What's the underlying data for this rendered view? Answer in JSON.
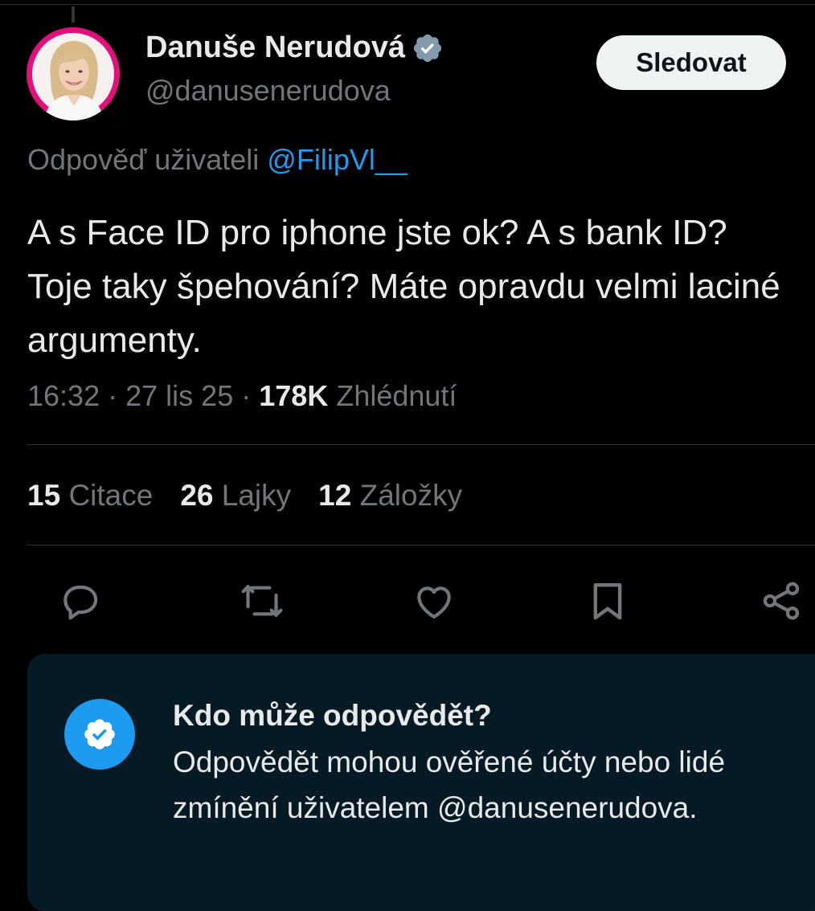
{
  "author": {
    "display_name": "Danuše Nerudová",
    "handle": "@danusenerudova",
    "verified": true
  },
  "follow_button": {
    "label": "Sledovat"
  },
  "reply_context": {
    "prefix": "Odpověď uživateli ",
    "mention": "@FilipVl__"
  },
  "tweet": {
    "text": "A s Face ID pro iphone jste ok? A s bank ID? Toje taky špehování? Máte opravdu velmi laciné argumenty."
  },
  "meta": {
    "time": "16:32",
    "separator": "·",
    "date": "27 lis 25",
    "views_count": "178K",
    "views_label": "Zhlédnutí"
  },
  "stats": [
    {
      "count": "15",
      "label": "Citace"
    },
    {
      "count": "26",
      "label": "Lajky"
    },
    {
      "count": "12",
      "label": "Záložky"
    }
  ],
  "actions": [
    {
      "icon": "reply-icon"
    },
    {
      "icon": "retweet-icon"
    },
    {
      "icon": "like-icon"
    },
    {
      "icon": "bookmark-icon"
    },
    {
      "icon": "share-icon"
    }
  ],
  "reply_restriction": {
    "title": "Kdo může odpovědět?",
    "body": "Odpovědět mohou ověřené účty nebo lidé zmínění uživatelem @danusenerudova."
  },
  "colors": {
    "background": "#000000",
    "text_primary": "#e7e9ea",
    "text_secondary": "#71767b",
    "accent_blue": "#1d9bf0",
    "avatar_ring": "#e0117a",
    "info_box_bg": "#061a26",
    "divider": "#2f3336"
  }
}
